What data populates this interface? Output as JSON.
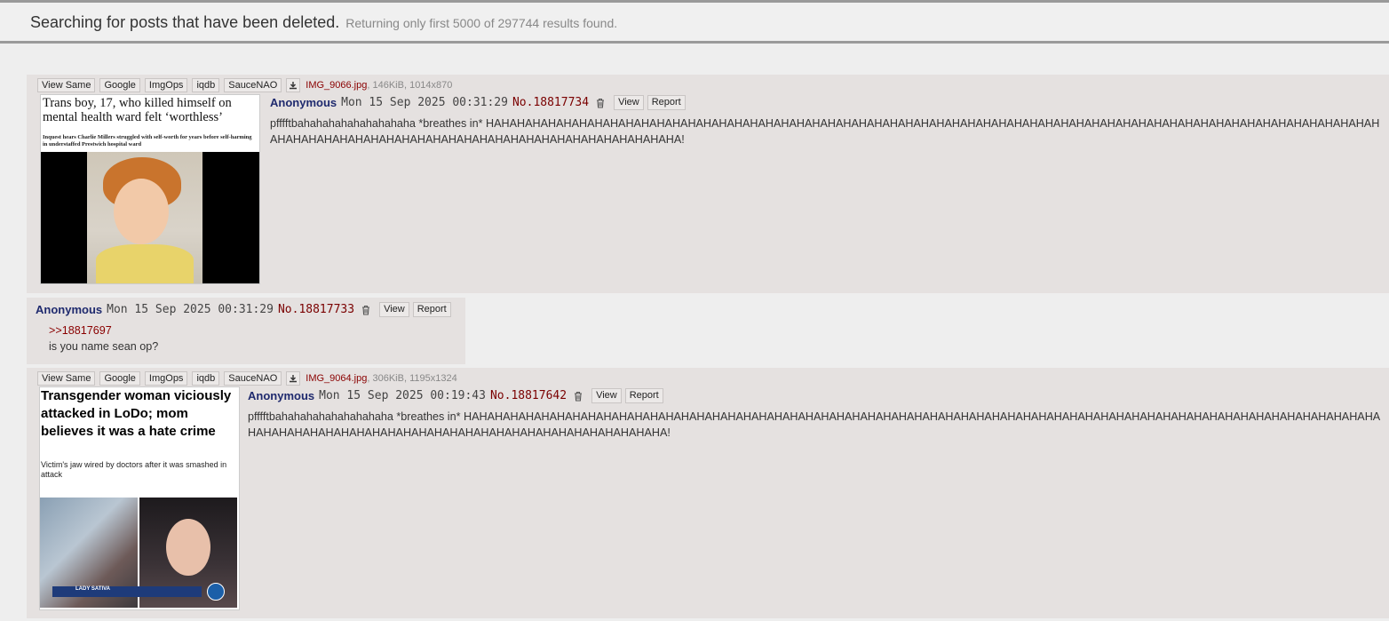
{
  "search": {
    "title": "Searching for posts that have been deleted.",
    "subtitle": "Returning only first 5000 of 297744 results found."
  },
  "file_buttons": [
    "View Same",
    "Google",
    "ImgOps",
    "iqdb",
    "SauceNAO"
  ],
  "post_buttons": {
    "view": "View",
    "report": "Report"
  },
  "posts": [
    {
      "file": {
        "name": "IMG_9066.jpg",
        "info": ", 146KiB, 1014x870"
      },
      "thumb": {
        "headline": "Trans boy, 17, who killed himself on mental health ward felt ‘worthless’",
        "sub": "Inquest hears Charlie Millers struggled with self-worth for years before self-harming in understaffed Prestwich hospital ward"
      },
      "name": "Anonymous",
      "date": "Mon 15 Sep 2025 00:31:29",
      "number": "No.18817734",
      "body": "pfffftbahahahahahahahahaha *breathes in* HAHAHAHAHAHAHAHAHAHAHAHAHAHAHAHAHAHAHAHAHAHAHAHAHAHAHAHAHAHAHAHAHAHAHAHAHAHAHAHAHAHAHAHAHAHAHAHAHAHAHAHAHAHAHAHAHAHAHAHAHAHAHAHAHAHAHAHAHAHAHAHAHAHAHAHAHAHAHAHAHAHAHAHA!"
    },
    {
      "name": "Anonymous",
      "date": "Mon 15 Sep 2025 00:31:29",
      "number": "No.18817733",
      "quote": ">>18817697",
      "body": "is you name sean op?"
    },
    {
      "file": {
        "name": "IMG_9064.jpg",
        "info": ", 306KiB, 1195x1324"
      },
      "thumb": {
        "headline": "Transgender woman viciously attacked in LoDo; mom believes it was a hate crime",
        "sub": "Victim's jaw wired by doctors after it was smashed in attack",
        "banner": "LADY SATIVA"
      },
      "name": "Anonymous",
      "date": "Mon 15 Sep 2025 00:19:43",
      "number": "No.18817642",
      "body": "pfffftbahahahahahahahahaha *breathes in* HAHAHAHAHAHAHAHAHAHAHAHAHAHAHAHAHAHAHAHAHAHAHAHAHAHAHAHAHAHAHAHAHAHAHAHAHAHAHAHAHAHAHAHAHAHAHAHAHAHAHAHAHAHAHAHAHAHAHAHAHAHAHAHAHAHAHAHAHAHAHAHAHAHAHAHAHAHAHAHAHAHAHAHAHAHA!"
    }
  ]
}
